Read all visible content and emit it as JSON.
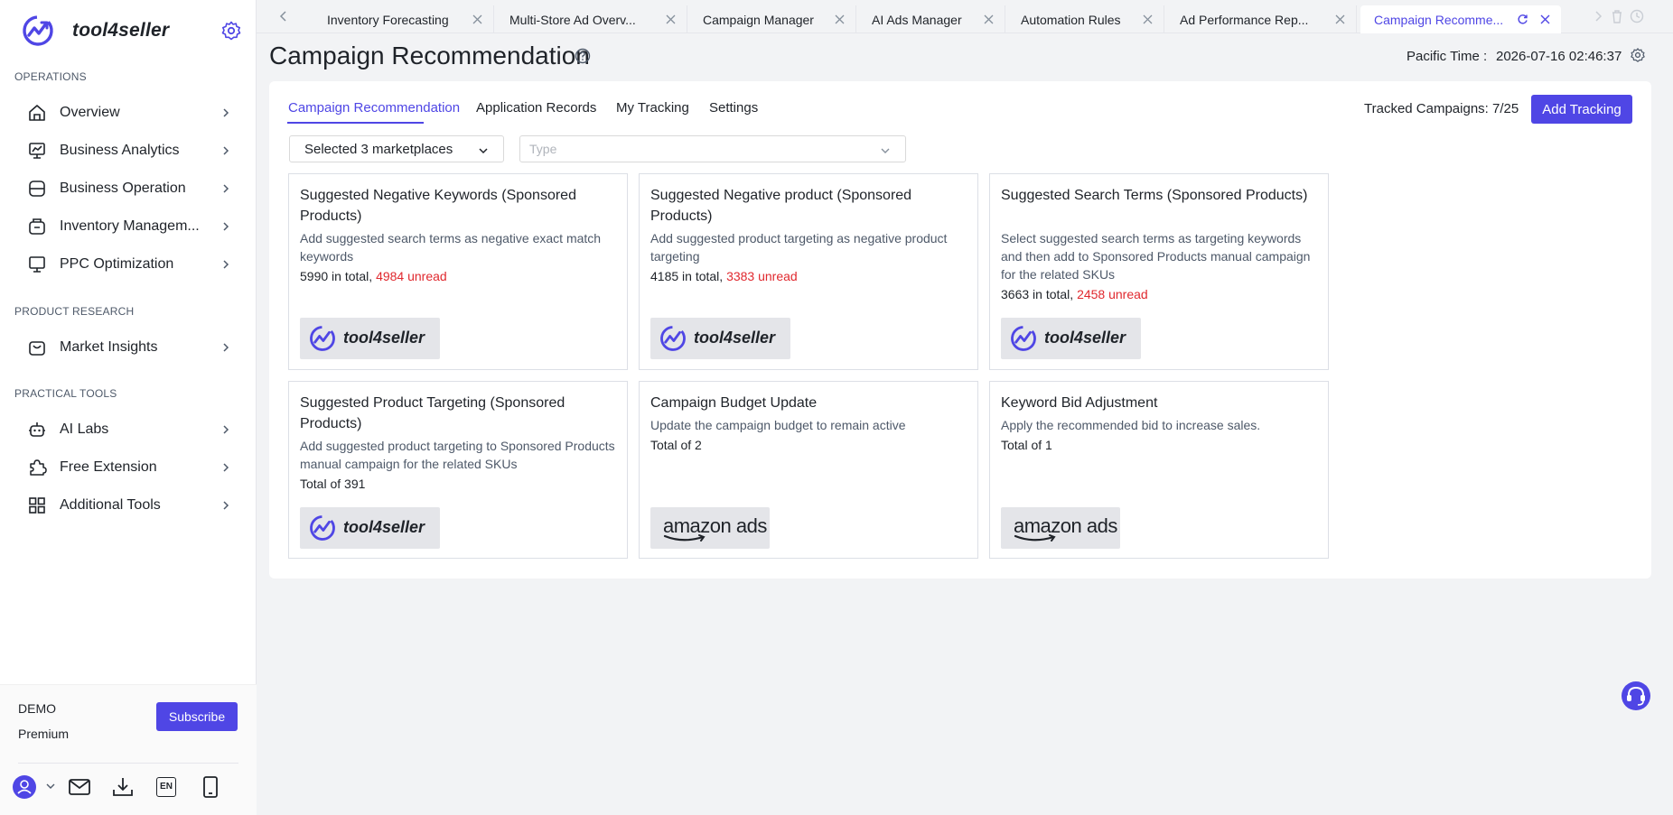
{
  "brand": {
    "name": "tool4seller"
  },
  "sidebar": {
    "sections": [
      {
        "label": "OPERATIONS"
      },
      {
        "label": "PRODUCT RESEARCH"
      },
      {
        "label": "PRACTICAL TOOLS"
      }
    ],
    "items": [
      {
        "label": "Overview",
        "icon": "home-icon"
      },
      {
        "label": "Business Analytics",
        "icon": "analytics-icon"
      },
      {
        "label": "Business Operation",
        "icon": "operation-icon"
      },
      {
        "label": "Inventory Managem...",
        "icon": "inventory-icon"
      },
      {
        "label": "PPC Optimization",
        "icon": "monitor-icon"
      },
      {
        "label": "Market Insights",
        "icon": "bag-icon"
      },
      {
        "label": "AI Labs",
        "icon": "robot-icon"
      },
      {
        "label": "Free Extension",
        "icon": "puzzle-icon"
      },
      {
        "label": "Additional Tools",
        "icon": "grid-icon"
      }
    ],
    "footer": {
      "plan_name": "DEMO",
      "plan_tier": "Premium",
      "subscribe_label": "Subscribe",
      "lang_badge": "EN"
    }
  },
  "tabs": [
    {
      "label": "Inventory Forecasting"
    },
    {
      "label": "Multi-Store Ad Overv..."
    },
    {
      "label": "Campaign Manager"
    },
    {
      "label": "AI Ads Manager"
    },
    {
      "label": "Automation Rules"
    },
    {
      "label": "Ad Performance Rep..."
    },
    {
      "label": "Campaign Recomme...",
      "active": true
    }
  ],
  "header": {
    "title": "Campaign Recommendation",
    "pacific_label": "Pacific Time :",
    "pacific_value": "2026-07-16 02:46:37"
  },
  "subtabs": [
    "Campaign Recommendation",
    "Application Records",
    "My Tracking",
    "Settings"
  ],
  "tracking": {
    "text": "Tracked Campaigns: 7/25",
    "add_label": "Add Tracking"
  },
  "filters": {
    "marketplaces_value": "Selected 3 marketplaces",
    "type_placeholder": "Type"
  },
  "cards": [
    {
      "title": "Suggested Negative Keywords (Sponsored Products)",
      "desc": "Add suggested search terms as negative exact match keywords",
      "total": "5990 in total,",
      "unread": "4984 unread",
      "logo": "tool4seller"
    },
    {
      "title": "Suggested Negative product (Sponsored Products)",
      "desc": "Add suggested product targeting as negative product targeting",
      "total": "4185 in total,",
      "unread": "3383 unread",
      "logo": "tool4seller"
    },
    {
      "title": "Suggested Search Terms (Sponsored Products)",
      "desc": "Select suggested search terms as targeting keywords and then add to Sponsored Products manual campaign for the related SKUs",
      "total": "3663 in total,",
      "unread": "2458 unread",
      "logo": "tool4seller"
    },
    {
      "title": "Suggested Product Targeting (Sponsored Products)",
      "desc": "Add suggested product targeting to Sponsored Products manual campaign for the related SKUs",
      "total": "Total of 391",
      "logo": "tool4seller"
    },
    {
      "title": "Campaign Budget Update",
      "desc": "Update the campaign budget to remain active",
      "total": "Total of 2",
      "logo": "amazon ads"
    },
    {
      "title": "Keyword Bid Adjustment",
      "desc": "Apply the recommended bid to increase sales.",
      "total": "Total of 1",
      "logo": "amazon ads"
    }
  ],
  "colors": {
    "accent": "#4f46e5",
    "unread": "#e0282e"
  }
}
